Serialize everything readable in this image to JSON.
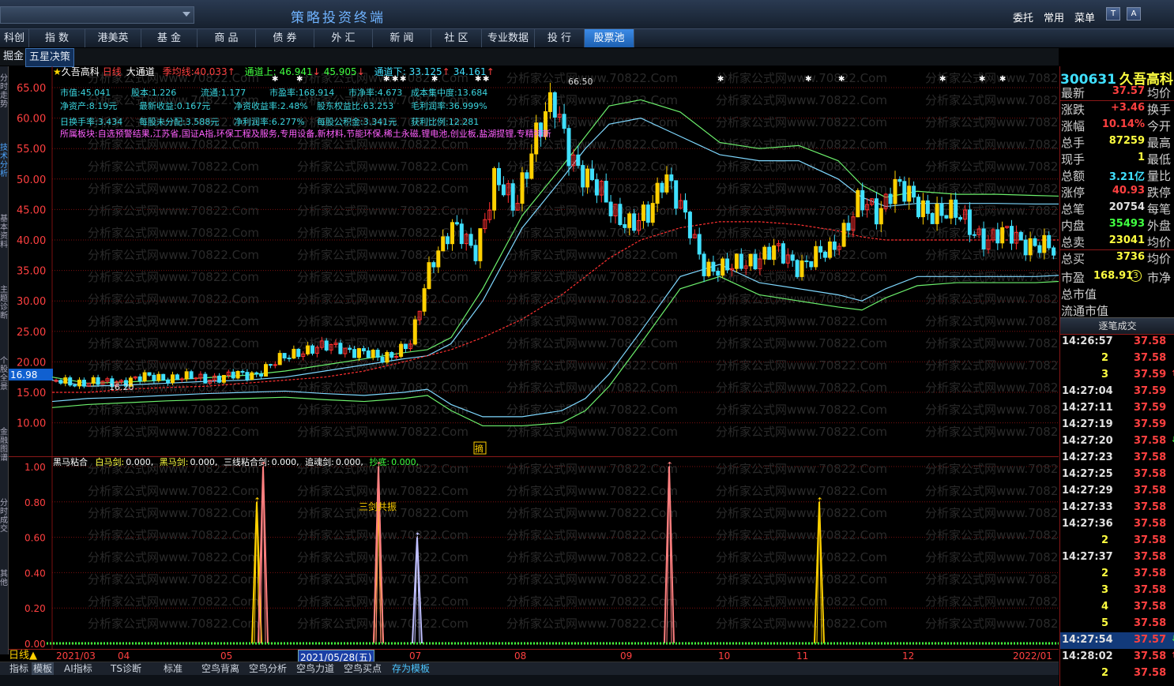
{
  "titlebar": {
    "app_title": "策略投资终端",
    "links": [
      "委托",
      "常用",
      "菜单"
    ],
    "icon_t": "T",
    "icon_a": "A"
  },
  "nav": [
    "科创板",
    "指 数",
    "港美英",
    "基 金",
    "商 品",
    "债 券",
    "外 汇",
    "新 闻",
    "社 区",
    "专业数据",
    "投 行",
    "股票池"
  ],
  "subnav": [
    "掘金",
    "五星决策"
  ],
  "leftbar": [
    "分时走势",
    "技术分析",
    "基本资料",
    "主题诊断",
    "个股全景",
    "金融图谱",
    "分时成交",
    "其他"
  ],
  "stock": {
    "code": "300631",
    "name": "久吾高科",
    "period": "日线",
    "indicator_name": "大通道"
  },
  "legend": {
    "ma_label": "季均线:",
    "ma_value": "40.033",
    "up_label": "通道上:",
    "up_v1": "46.941",
    "up_v2": "45.905",
    "down_label": "通道下:",
    "down_v1": "33.125",
    "down_v2": "34.161"
  },
  "info_lines": [
    [
      "市值:45.041",
      "股本:1.226",
      "流通:1.177",
      "市盈率:168.914",
      "市净率:4.673",
      "成本集中度:13.684"
    ],
    [
      "净资产:8.19元",
      "最新收益:0.167元",
      "净资收益率:2.48%",
      "股东权益比:63.253",
      "毛利润率:36.999%"
    ],
    [
      "日换手率:3.434",
      "每股未分配:3.588元",
      "净利润率:6.277%",
      "每股公积金:3.341元",
      "获利比例:12.281"
    ]
  ],
  "sector": "所属板块:自选预警结果,江苏省,国证A指,环保工程及服务,专用设备,新材料,节能环保,稀土永磁,锂电池,创业板,盐湖提锂,专精特新",
  "price_axis": [
    "65.00",
    "60.00",
    "55.00",
    "50.00",
    "45.00",
    "40.00",
    "35.00",
    "30.00",
    "25.00",
    "20.00",
    "15.00",
    "10.00"
  ],
  "current_price_tag": "16.98",
  "hi_label": "66.50",
  "lo_label": "16.20",
  "watermark": "分析家公式网www.70822.Com",
  "indicator": {
    "title": "黑马粘合",
    "items": [
      [
        "白马剑:",
        "0.000,"
      ],
      [
        "黑马剑:",
        "0.000,"
      ],
      [
        "三线粘合剑:",
        "0.000,"
      ],
      [
        "追魂剑:",
        "0.000,"
      ],
      [
        "抄底:",
        "0.000,"
      ]
    ],
    "axis": [
      "1.00",
      "0.80",
      "0.60",
      "0.40",
      "0.20",
      "0.00"
    ],
    "annotation": "三剑共振",
    "marker": "摘"
  },
  "date_axis": {
    "period_btn": "日线",
    "labels": [
      "2021/03",
      "04",
      "05",
      "2021/05/28(五)",
      "07",
      "08",
      "09",
      "10",
      "11",
      "12",
      "2022/01"
    ]
  },
  "bottom_tabs": [
    "指标",
    "模板",
    "AI指标",
    "TS诊断",
    "标准",
    "空鸟背离",
    "空鸟分析",
    "空鸟力道",
    "空鸟买点",
    "存为模板"
  ],
  "quote": {
    "title_code": "300631",
    "title_name": "久吾高科",
    "rows": [
      {
        "l": "最新",
        "v": "37.57",
        "c": "#ff4040",
        "r": "均价"
      },
      {
        "l": "涨跌",
        "v": "+3.46",
        "c": "#ff4040",
        "r": "换手"
      },
      {
        "l": "涨幅",
        "v": "10.14%",
        "c": "#ff4040",
        "r": "今开"
      },
      {
        "l": "总手",
        "v": "87259",
        "c": "#ffff40",
        "r": "最高"
      },
      {
        "l": "现手",
        "v": "1",
        "c": "#ffff40",
        "r": "最低"
      },
      {
        "l": "总额",
        "v": "3.21亿",
        "c": "#40e0ff",
        "r": "量比"
      },
      {
        "l": "涨停",
        "v": "40.93",
        "c": "#ff4040",
        "r": "跌停"
      },
      {
        "l": "总笔",
        "v": "20754",
        "c": "#e0e0e0",
        "r": "每笔"
      },
      {
        "l": "内盘",
        "v": "35493",
        "c": "#40ff40",
        "r": "外盘"
      },
      {
        "l": "总卖",
        "v": "23041",
        "c": "#ffff40",
        "r": "均价"
      },
      {
        "l": "总买",
        "v": "3736",
        "c": "#ffff40",
        "r": "均价"
      }
    ],
    "pe_label": "市盈",
    "pe_value": "168.91",
    "pe_badge": "3",
    "pe_right": "市净",
    "mktcap_label": "总市值",
    "float_label": "流通市值",
    "tick_header": "逐笔成交"
  },
  "ticks": [
    {
      "t": "14:26:57",
      "p": "37.58",
      "f": ""
    },
    {
      "t": "2",
      "p": "37.58",
      "f": ""
    },
    {
      "t": "3",
      "p": "37.59",
      "f": "up"
    },
    {
      "t": "14:27:04",
      "p": "37.59",
      "f": ""
    },
    {
      "t": "14:27:11",
      "p": "37.59",
      "f": ""
    },
    {
      "t": "14:27:19",
      "p": "37.59",
      "f": ""
    },
    {
      "t": "14:27:20",
      "p": "37.58",
      "f": "down"
    },
    {
      "t": "14:27:23",
      "p": "37.58",
      "f": ""
    },
    {
      "t": "14:27:25",
      "p": "37.58",
      "f": ""
    },
    {
      "t": "14:27:29",
      "p": "37.58",
      "f": ""
    },
    {
      "t": "14:27:33",
      "p": "37.58",
      "f": ""
    },
    {
      "t": "14:27:36",
      "p": "37.58",
      "f": ""
    },
    {
      "t": "2",
      "p": "37.58",
      "f": ""
    },
    {
      "t": "14:27:37",
      "p": "37.58",
      "f": ""
    },
    {
      "t": "2",
      "p": "37.58",
      "f": ""
    },
    {
      "t": "3",
      "p": "37.58",
      "f": ""
    },
    {
      "t": "4",
      "p": "37.58",
      "f": ""
    },
    {
      "t": "5",
      "p": "37.58",
      "f": ""
    },
    {
      "t": "14:27:54",
      "p": "37.57",
      "f": "down"
    },
    {
      "t": "14:28:02",
      "p": "37.58",
      "f": "up"
    },
    {
      "t": "2",
      "p": "37.58",
      "f": ""
    }
  ],
  "colors": {
    "up": "#ff3030",
    "down": "#40e0ff",
    "yellow": "#ffd000",
    "band_up": "#6cf06c",
    "band_mid": "#7fd8ff",
    "ma": "#ff3030",
    "grid": "#7a1010"
  }
}
